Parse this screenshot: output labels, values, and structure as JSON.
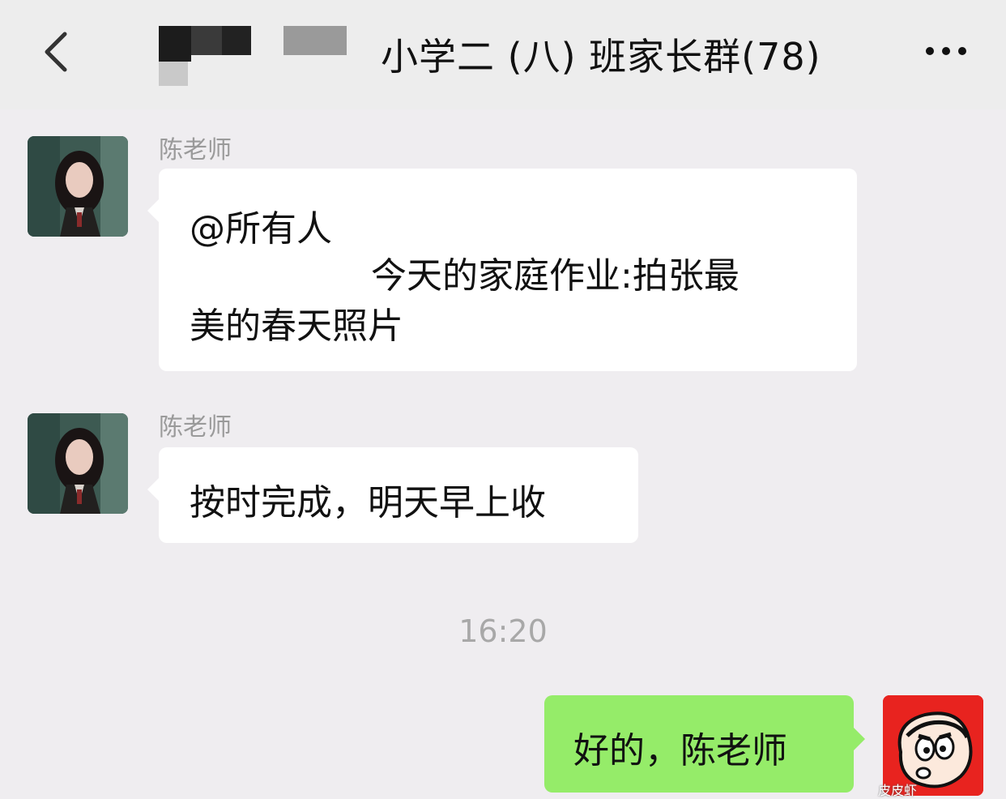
{
  "header": {
    "back_icon": "chevron-left-icon",
    "title": "小学二 (八) 班家长群(78)",
    "more_icon": "more-horizontal-icon"
  },
  "messages": [
    {
      "sender": "陈老师",
      "lines": [
        "@所有人",
        "今天的家庭作业:拍张最",
        "美的春天照片"
      ],
      "side": "left"
    },
    {
      "sender": "陈老师",
      "text": "按时完成，明天早上收",
      "side": "left"
    },
    {
      "timestamp": "16:20"
    },
    {
      "text": "好的，陈老师",
      "side": "right"
    }
  ],
  "watermark": "皮皮虾",
  "colors": {
    "background": "#efedf0",
    "own_bubble": "#95ec69",
    "other_bubble": "#ffffff",
    "self_avatar_bg": "#e8231f"
  }
}
